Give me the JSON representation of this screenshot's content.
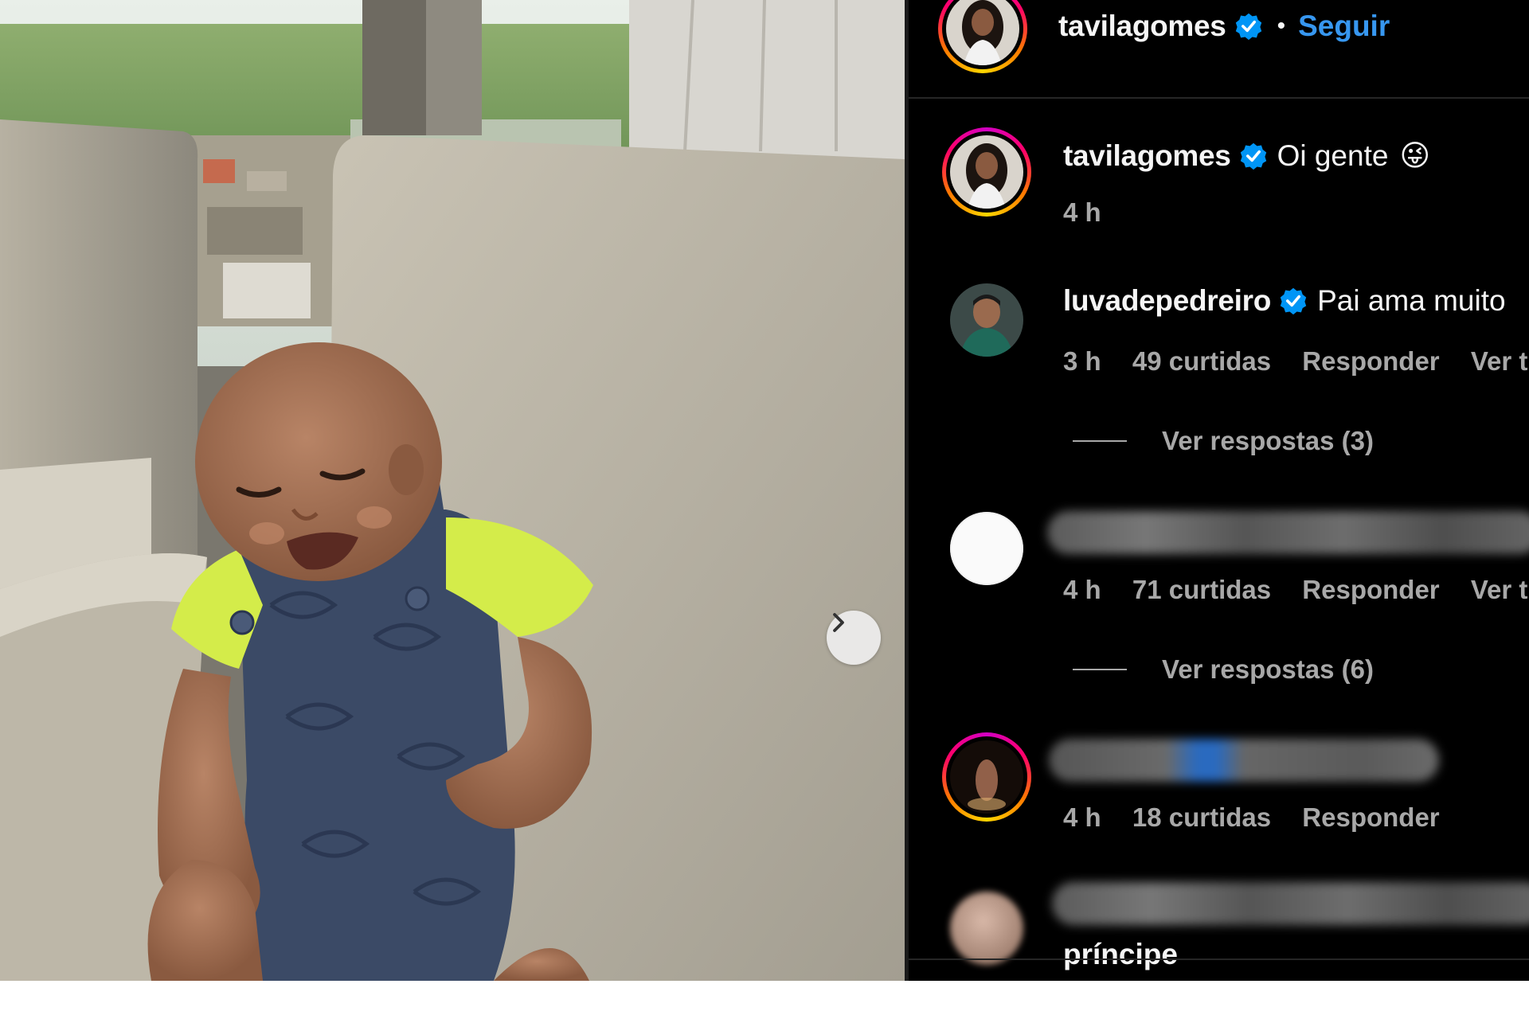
{
  "post": {
    "photo_alt": "",
    "next_icon": "chevron-right-icon"
  },
  "header": {
    "username": "tavilagomes",
    "separator": "•",
    "follow_label": "Seguir"
  },
  "caption": {
    "username": "tavilagomes",
    "text": "Oi gente",
    "emoji": "😜",
    "time": "4 h"
  },
  "comments": [
    {
      "username": "luvadepedreiro",
      "text": "Pai ama muito",
      "time": "3 h",
      "likes": "49 curtidas",
      "reply_label": "Responder",
      "translate_label": "Ver tra",
      "view_replies": "Ver respostas (3)"
    },
    {
      "username": "",
      "text": "",
      "time": "4 h",
      "likes": "71 curtidas",
      "reply_label": "Responder",
      "translate_label": "Ver tra",
      "view_replies": "Ver respostas (6)"
    },
    {
      "username": "",
      "text": "",
      "time": "4 h",
      "likes": "18 curtidas",
      "reply_label": "Responder"
    },
    {
      "partial_text": "príncipe"
    }
  ],
  "colors": {
    "background": "#000000",
    "link": "#3797f0",
    "meta_text": "#a8a8a8",
    "verified": "#0095f6"
  }
}
